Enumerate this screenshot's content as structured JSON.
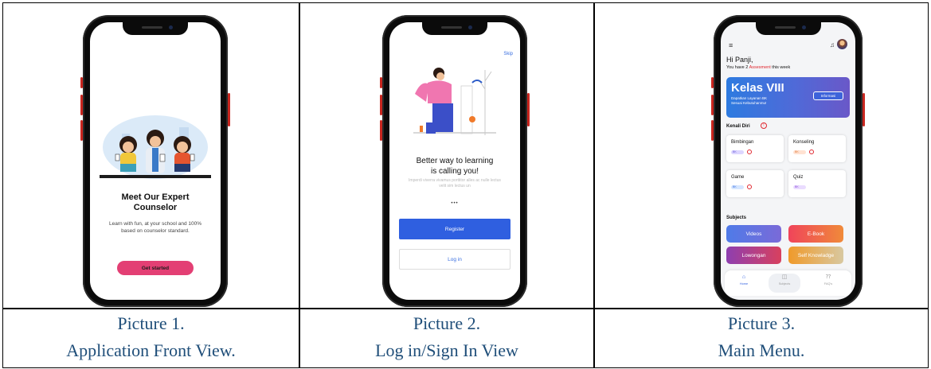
{
  "captions": [
    {
      "line1": "Picture 1.",
      "line2": "Application Front View."
    },
    {
      "line1": "Picture 2.",
      "line2": "Log in/Sign In View"
    },
    {
      "line1": "Picture 3.",
      "line2": "Main Menu."
    }
  ],
  "screen1": {
    "title_line1": "Meet Our Expert",
    "title_line2": "Counselor",
    "subtitle": "Learn with fun, at your school and 100% based on counselor standard.",
    "button": "Get started",
    "accent": "#e33f74"
  },
  "screen2": {
    "skip": "Skip",
    "title_line1": "Better way to learning",
    "title_line2": "is calling you!",
    "subtitle": "Imperdi viverra vivamus porttitor alles ac nulle lectus velit sim lectus un",
    "page_indicator": "•••",
    "register": "Register",
    "login": "Log in",
    "accent": "#2f5fe0"
  },
  "screen3": {
    "greeting": "Hi Panji,",
    "have_prefix": "You have 2 ",
    "have_highlight": "Assesment",
    "have_suffix": " this week",
    "banner_title": "Kelas VIII",
    "banner_sub": "Dapatkan Layanan BK Sesuai Kebutuhanmu!",
    "banner_button": "Informasi",
    "section_kenali": "Kenali Diri",
    "cards": [
      {
        "title": "Bimbingan",
        "pill": "BK",
        "pill_color": "#dcd6ff"
      },
      {
        "title": "Konseling",
        "pill": "BK",
        "pill_color": "#ffe2d2"
      },
      {
        "title": "Game",
        "pill": "BK",
        "pill_color": "#d6e6ff"
      },
      {
        "title": "Quiz",
        "pill": "BK",
        "pill_color": "#eadcff"
      }
    ],
    "section_subjects": "Subjects",
    "subjects": [
      {
        "label": "Videos",
        "from": "#4f7be8",
        "to": "#7a6ad8"
      },
      {
        "label": "E-Book",
        "from": "#f0445a",
        "to": "#f08a3a"
      },
      {
        "label": "Lowongan",
        "from": "#8e3fb0",
        "to": "#d8405e"
      },
      {
        "label": "Self Knowladge",
        "from": "#f09a2a",
        "to": "#f0b440"
      }
    ],
    "nav": [
      {
        "icon": "home-icon",
        "label": "Home"
      },
      {
        "icon": "book-icon",
        "label": "Subjects"
      },
      {
        "icon": "faq-icon",
        "label": "FAQ's"
      }
    ]
  }
}
